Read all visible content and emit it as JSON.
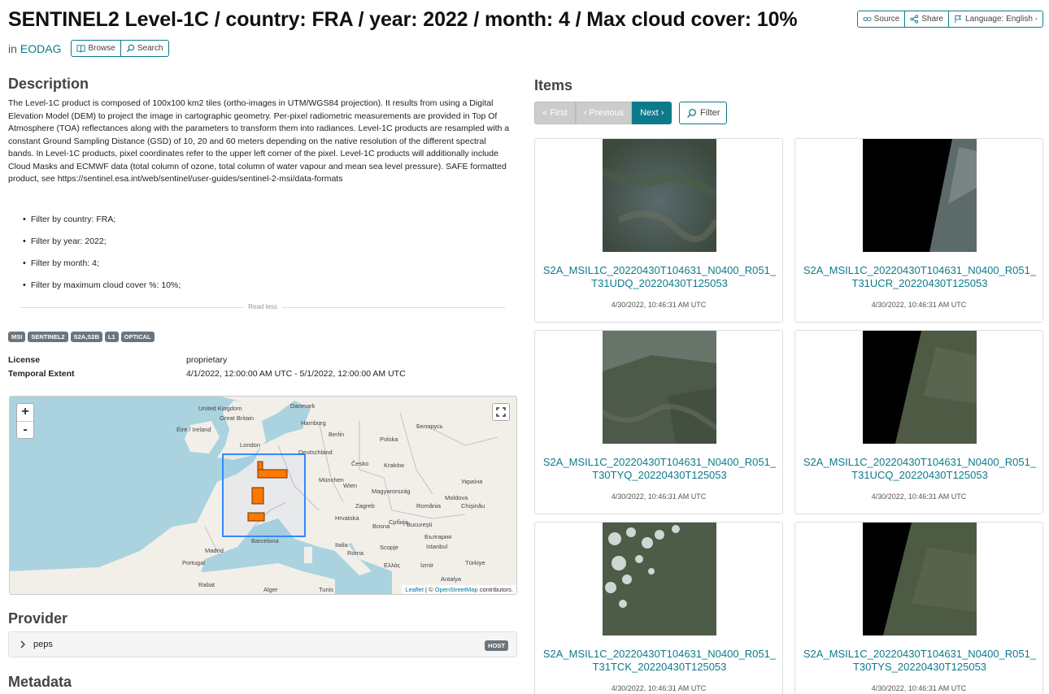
{
  "header": {
    "title": "SENTINEL2 Level-1C / country: FRA / year: 2022 / month: 4 / Max cloud cover: 10%",
    "in_label": "in",
    "catalog_link": "EODAG",
    "browse_label": "Browse",
    "search_label": "Search",
    "source_label": "Source",
    "share_label": "Share",
    "language_label": "Language: English -"
  },
  "description": {
    "heading": "Description",
    "text": "The Level-1C product is composed of 100x100 km2 tiles (ortho-images in UTM/WGS84 projection). It results from using a Digital Elevation Model (DEM) to project the image in cartographic geometry. Per-pixel radiometric measurements are provided in Top Of Atmosphere (TOA) reflectances along with the parameters to transform them into radiances. Level-1C products are resampled with a constant Ground Sampling Distance (GSD) of 10, 20 and 60 meters depending on the native resolution of the different spectral bands. In Level-1C products, pixel coordinates refer to the upper left corner of the pixel. Level-1C products will additionally include Cloud Masks and ECMWF data (total column of ozone, total column of water vapour and mean sea level pressure). SAFE formatted product, see https://sentinel.esa.int/web/sentinel/user-guides/sentinel-2-msi/data-formats",
    "filters": [
      "Filter by country: FRA;",
      "Filter by year: 2022;",
      "Filter by month: 4;",
      "Filter by maximum cloud cover %: 10%;"
    ],
    "read_less": "Read less"
  },
  "keywords": [
    "MSI",
    "SENTINEL2",
    "S2A,S2B",
    "L1",
    "OPTICAL"
  ],
  "metadata_rows": [
    {
      "key": "License",
      "value": "proprietary"
    },
    {
      "key": "Temporal Extent",
      "value": "4/1/2022, 12:00:00 AM UTC - 5/1/2022, 12:00:00 AM UTC"
    }
  ],
  "map": {
    "zoom_in": "+",
    "zoom_out": "-",
    "attribution_leaflet": "Leaflet",
    "attribution_sep": " | © ",
    "attribution_osm": "OpenStreetMap",
    "attribution_tail": " contributors.",
    "labels": [
      "Danmark",
      "United Kingdom",
      "Great Britain",
      "Éire / Ireland",
      "Hamburg",
      "Berlin",
      "Polska",
      "Беларусь",
      "London",
      "Deutschland",
      "Kraków",
      "Україна",
      "Česko",
      "München",
      "Magyarország",
      "Moldova",
      "Chişinău",
      "Wien",
      "Zagreb",
      "România",
      "Hrvatska",
      "Bucureşti",
      "Србија",
      "Bosna",
      "Italia",
      "България",
      "Istanbul",
      "Portugal",
      "Roma",
      "Barcelona",
      "Madrid",
      "Scopje",
      "Ελλάς",
      "İzmir",
      "Türkiye",
      "Antalya",
      "Rabat",
      "Alger",
      "Tunis"
    ],
    "accent_color": "#3388ff",
    "footprint_color": "#ff7800"
  },
  "provider": {
    "heading": "Provider",
    "name": "peps",
    "badge": "HOST"
  },
  "metadata_heading": "Metadata",
  "items": {
    "heading": "Items",
    "pager": {
      "first": "« First",
      "previous": "‹ Previous",
      "next": "Next ›"
    },
    "filter_label": "Filter",
    "cards": [
      {
        "name": "S2A_MSIL1C_20220430T104631_N0400_R051_T31UDQ_20220430T125053",
        "date": "4/30/2022, 10:46:31 AM UTC"
      },
      {
        "name": "S2A_MSIL1C_20220430T104631_N0400_R051_T31UCR_20220430T125053",
        "date": "4/30/2022, 10:46:31 AM UTC"
      },
      {
        "name": "S2A_MSIL1C_20220430T104631_N0400_R051_T30TYQ_20220430T125053",
        "date": "4/30/2022, 10:46:31 AM UTC"
      },
      {
        "name": "S2A_MSIL1C_20220430T104631_N0400_R051_T31UCQ_20220430T125053",
        "date": "4/30/2022, 10:46:31 AM UTC"
      },
      {
        "name": "S2A_MSIL1C_20220430T104631_N0400_R051_T31TCK_20220430T125053",
        "date": "4/30/2022, 10:46:31 AM UTC"
      },
      {
        "name": "S2A_MSIL1C_20220430T104631_N0400_R051_T30TYS_20220430T125053",
        "date": "4/30/2022, 10:46:31 AM UTC"
      }
    ]
  },
  "colors": {
    "accent": "#0d7a8c",
    "badge": "#6c757d"
  }
}
